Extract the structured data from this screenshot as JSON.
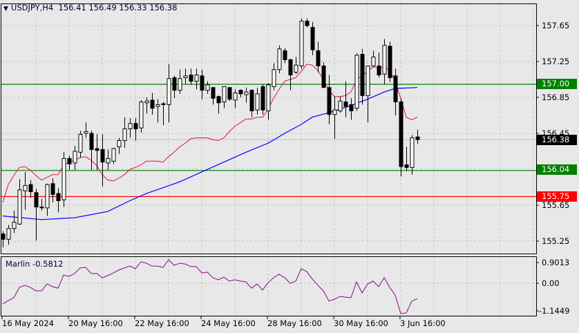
{
  "header": {
    "symbol": "USDJPY,H4",
    "open": "156.41",
    "high": "156.49",
    "low": "156.33",
    "close": "156.38",
    "menu_icon": "triangle-down-icon"
  },
  "indicator": {
    "name": "Marlin",
    "value": "-0.5812",
    "axis_labels": [
      "0.9013",
      "0.00",
      "-1.1449"
    ],
    "color": "#8b008b"
  },
  "price_axis": {
    "labels": [
      "157.65",
      "157.25",
      "156.85",
      "156.45",
      "155.65",
      "155.25"
    ]
  },
  "levels": [
    {
      "label": "157.00",
      "price": 157.0,
      "color": "#008000"
    },
    {
      "label": "156.04",
      "price": 156.04,
      "color": "#008000"
    },
    {
      "label": "155.75",
      "price": 155.75,
      "color": "#ff0000"
    }
  ],
  "current_price": {
    "label": "156.38",
    "price": 156.38,
    "color": "#000000"
  },
  "date_axis": {
    "labels": [
      "16 May 2024",
      "20 May 16:00",
      "22 May 16:00",
      "24 May 16:00",
      "28 May 16:00",
      "30 May 16:00",
      "3 Jun 16:00"
    ]
  },
  "chart_data": {
    "type": "candlestick",
    "title": "USDJPY,H4",
    "ylim": [
      155.12,
      157.88
    ],
    "candles_ohlc": [
      [
        155.33,
        155.36,
        155.18,
        155.27
      ],
      [
        155.27,
        155.43,
        155.21,
        155.39
      ],
      [
        155.39,
        155.59,
        155.34,
        155.46
      ],
      [
        155.44,
        155.94,
        155.43,
        155.82
      ],
      [
        155.81,
        156.02,
        155.6,
        155.87
      ],
      [
        155.88,
        155.93,
        155.73,
        155.8
      ],
      [
        155.79,
        155.83,
        155.26,
        155.63
      ],
      [
        155.63,
        155.72,
        155.59,
        155.62
      ],
      [
        155.62,
        155.89,
        155.53,
        155.88
      ],
      [
        155.89,
        155.95,
        155.68,
        155.77
      ],
      [
        155.78,
        155.84,
        155.57,
        155.7
      ],
      [
        155.71,
        156.24,
        155.63,
        156.17
      ],
      [
        156.17,
        156.2,
        156.04,
        156.11
      ],
      [
        156.12,
        156.31,
        156.04,
        156.25
      ],
      [
        156.24,
        156.48,
        156.18,
        156.44
      ],
      [
        156.45,
        156.57,
        156.4,
        156.47
      ],
      [
        156.45,
        156.48,
        156.04,
        156.27
      ],
      [
        156.28,
        156.44,
        156.04,
        156.26
      ],
      [
        156.27,
        156.44,
        155.86,
        156.13
      ],
      [
        156.12,
        156.27,
        156.04,
        156.17
      ],
      [
        156.14,
        156.29,
        156.11,
        156.28
      ],
      [
        156.3,
        156.4,
        156.22,
        156.37
      ],
      [
        156.37,
        156.63,
        156.29,
        156.5
      ],
      [
        156.5,
        156.62,
        156.4,
        156.56
      ],
      [
        156.56,
        156.62,
        156.37,
        156.5
      ],
      [
        156.51,
        156.82,
        156.46,
        156.8
      ],
      [
        156.79,
        156.85,
        156.67,
        156.81
      ],
      [
        156.82,
        156.9,
        156.66,
        156.73
      ],
      [
        156.75,
        156.83,
        156.57,
        156.77
      ],
      [
        156.78,
        156.8,
        156.54,
        156.77
      ],
      [
        156.77,
        157.22,
        156.57,
        157.06
      ],
      [
        157.07,
        157.09,
        156.84,
        156.93
      ],
      [
        156.93,
        157.16,
        156.89,
        157.06
      ],
      [
        157.07,
        157.17,
        157.0,
        157.09
      ],
      [
        157.1,
        157.17,
        156.99,
        157.03
      ],
      [
        157.03,
        157.17,
        156.94,
        157.1
      ],
      [
        157.09,
        157.16,
        156.83,
        156.93
      ],
      [
        156.93,
        157.03,
        156.89,
        156.99
      ],
      [
        156.96,
        156.96,
        156.77,
        156.84
      ],
      [
        156.86,
        156.87,
        156.67,
        156.79
      ],
      [
        156.8,
        156.97,
        156.73,
        156.97
      ],
      [
        156.96,
        156.96,
        156.81,
        156.83
      ],
      [
        156.82,
        156.94,
        156.73,
        156.9
      ],
      [
        156.93,
        156.94,
        156.85,
        156.89
      ],
      [
        156.88,
        156.96,
        156.79,
        156.91
      ],
      [
        156.93,
        156.94,
        156.63,
        156.7
      ],
      [
        156.71,
        156.96,
        156.66,
        156.89
      ],
      [
        156.97,
        157.0,
        156.66,
        156.71
      ],
      [
        156.7,
        157.01,
        156.6,
        156.99
      ],
      [
        156.97,
        157.23,
        156.93,
        157.16
      ],
      [
        157.16,
        157.43,
        157.12,
        157.39
      ],
      [
        157.37,
        157.4,
        157.23,
        157.27
      ],
      [
        157.27,
        157.28,
        156.93,
        157.1
      ],
      [
        157.13,
        157.3,
        157.11,
        157.21
      ],
      [
        157.2,
        157.73,
        157.17,
        157.7
      ],
      [
        157.7,
        157.73,
        157.63,
        157.65
      ],
      [
        157.63,
        157.69,
        157.32,
        157.38
      ],
      [
        157.37,
        157.47,
        157.13,
        157.2
      ],
      [
        157.2,
        157.24,
        156.96,
        156.96
      ],
      [
        156.96,
        157.1,
        156.55,
        156.66
      ],
      [
        156.66,
        156.86,
        156.39,
        156.71
      ],
      [
        156.7,
        156.86,
        156.68,
        156.81
      ],
      [
        156.8,
        157.03,
        156.63,
        156.75
      ],
      [
        156.77,
        156.84,
        156.6,
        156.7
      ],
      [
        156.73,
        157.34,
        156.7,
        157.32
      ],
      [
        157.33,
        157.39,
        156.77,
        156.87
      ],
      [
        156.87,
        157.2,
        156.57,
        157.2
      ],
      [
        157.2,
        157.37,
        157.19,
        157.3
      ],
      [
        157.2,
        157.35,
        157.07,
        157.1
      ],
      [
        157.11,
        157.5,
        157.0,
        157.43
      ],
      [
        157.42,
        157.47,
        157.02,
        157.07
      ],
      [
        157.09,
        157.17,
        156.65,
        156.8
      ],
      [
        156.8,
        156.84,
        155.97,
        156.08
      ],
      [
        156.1,
        156.3,
        156.03,
        156.07
      ],
      [
        156.07,
        156.43,
        155.99,
        156.4
      ],
      [
        156.41,
        156.49,
        156.33,
        156.38
      ]
    ],
    "ma_fast": {
      "color": "#dc143c",
      "values": [
        155.68,
        155.88,
        155.98,
        156.07,
        156.08,
        156.04,
        155.98,
        155.93,
        155.96,
        155.99,
        155.99,
        156.09,
        156.13,
        156.15,
        156.18,
        156.19,
        156.15,
        156.09,
        155.99,
        155.93,
        155.92,
        155.95,
        155.99,
        156.05,
        156.07,
        156.1,
        156.14,
        156.14,
        156.14,
        156.13,
        156.19,
        156.24,
        156.3,
        156.34,
        156.39,
        156.4,
        156.4,
        156.4,
        156.38,
        156.37,
        156.4,
        156.47,
        156.53,
        156.57,
        156.61,
        156.61,
        156.63,
        156.63,
        156.72,
        156.84,
        156.94,
        157.03,
        157.05,
        157.07,
        157.14,
        157.22,
        157.21,
        157.15,
        157.05,
        156.93,
        156.86,
        156.86,
        156.87,
        156.91,
        157.05,
        157.09,
        157.14,
        157.19,
        157.18,
        157.19,
        157.15,
        157.03,
        156.84,
        156.63,
        156.6,
        156.63
      ]
    },
    "ma_slow": {
      "color": "#0000ff",
      "points": [
        [
          0,
          155.53
        ],
        [
          7,
          155.49
        ],
        [
          10,
          155.5
        ],
        [
          13,
          155.51
        ],
        [
          19,
          155.58
        ],
        [
          23,
          155.7
        ],
        [
          26,
          155.78
        ],
        [
          32,
          155.91
        ],
        [
          44,
          156.24
        ],
        [
          48,
          156.34
        ],
        [
          51,
          156.45
        ],
        [
          54,
          156.55
        ],
        [
          56,
          156.63
        ],
        [
          59,
          156.68
        ],
        [
          63,
          156.76
        ],
        [
          66,
          156.83
        ],
        [
          69,
          156.91
        ],
        [
          71,
          156.95
        ],
        [
          75,
          156.96
        ]
      ]
    },
    "marlin": [
      -0.78,
      -0.65,
      -0.54,
      -0.15,
      -0.07,
      -0.15,
      -0.28,
      -0.28,
      -0.02,
      -0.12,
      -0.18,
      0.32,
      0.27,
      0.38,
      0.59,
      0.61,
      0.38,
      0.38,
      0.22,
      0.3,
      0.4,
      0.51,
      0.59,
      0.66,
      0.56,
      0.82,
      0.77,
      0.66,
      0.66,
      0.61,
      0.9013,
      0.69,
      0.77,
      0.74,
      0.64,
      0.64,
      0.4,
      0.43,
      0.22,
      0.14,
      0.24,
      0.09,
      0.14,
      0.09,
      0.06,
      -0.18,
      -0.02,
      -0.25,
      0.03,
      0.22,
      0.35,
      0.22,
      0.01,
      0.09,
      0.56,
      0.45,
      0.17,
      -0.07,
      -0.28,
      -0.67,
      -0.6,
      -0.49,
      -0.52,
      -0.54,
      0.06,
      -0.36,
      -0.02,
      0.09,
      -0.12,
      0.22,
      -0.15,
      -0.44,
      -1.1449,
      -1.12,
      -0.67,
      -0.5812
    ]
  }
}
